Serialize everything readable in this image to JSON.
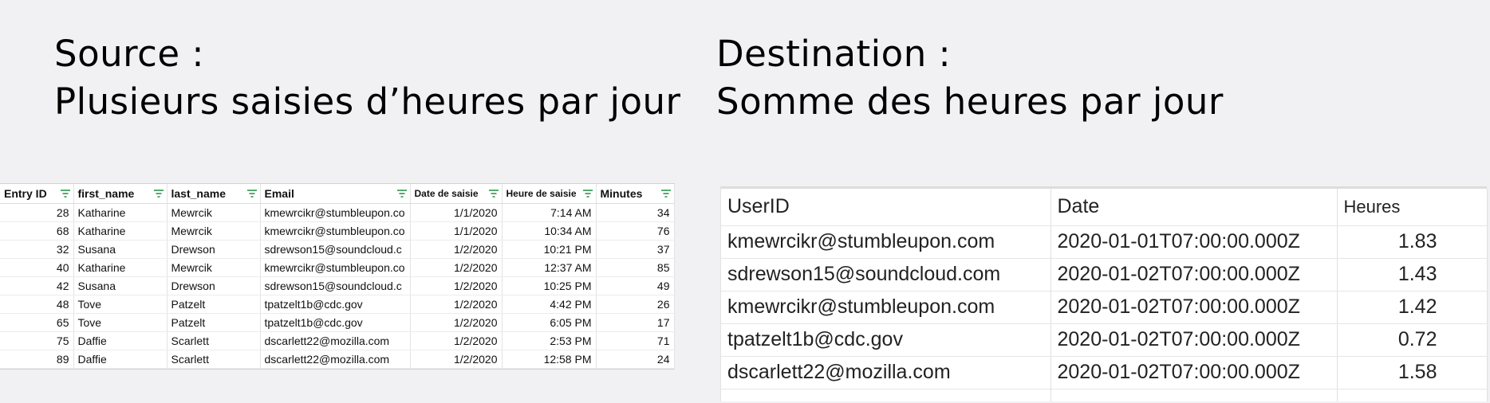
{
  "source": {
    "heading_line1": "Source :",
    "heading_line2": "Plusieurs saisies d’heures par jour",
    "columns": [
      "Entry ID",
      "first_name",
      "last_name",
      "Email",
      "Date de saisie",
      "Heure de saisie",
      "Minutes"
    ],
    "rows": [
      [
        "28",
        "Katharine",
        "Mewrcik",
        "kmewrcikr@stumbleupon.co",
        "1/1/2020",
        "7:14 AM",
        "34"
      ],
      [
        "68",
        "Katharine",
        "Mewrcik",
        "kmewrcikr@stumbleupon.co",
        "1/1/2020",
        "10:34 AM",
        "76"
      ],
      [
        "32",
        "Susana",
        "Drewson",
        "sdrewson15@soundcloud.c",
        "1/2/2020",
        "10:21 PM",
        "37"
      ],
      [
        "40",
        "Katharine",
        "Mewrcik",
        "kmewrcikr@stumbleupon.co",
        "1/2/2020",
        "12:37 AM",
        "85"
      ],
      [
        "42",
        "Susana",
        "Drewson",
        "sdrewson15@soundcloud.c",
        "1/2/2020",
        "10:25 PM",
        "49"
      ],
      [
        "48",
        "Tove",
        "Patzelt",
        "tpatzelt1b@cdc.gov",
        "1/2/2020",
        "4:42 PM",
        "26"
      ],
      [
        "65",
        "Tove",
        "Patzelt",
        "tpatzelt1b@cdc.gov",
        "1/2/2020",
        "6:05 PM",
        "17"
      ],
      [
        "75",
        "Daffie",
        "Scarlett",
        "dscarlett22@mozilla.com",
        "1/2/2020",
        "2:53 PM",
        "71"
      ],
      [
        "89",
        "Daffie",
        "Scarlett",
        "dscarlett22@mozilla.com",
        "1/2/2020",
        "12:58 PM",
        "24"
      ]
    ],
    "filter_color": "#1e8e3e"
  },
  "destination": {
    "heading_line1": "Destination :",
    "heading_line2": "Somme des heures par jour",
    "columns": [
      "UserID",
      "Date",
      "Heures"
    ],
    "rows": [
      [
        "kmewrcikr@stumbleupon.com",
        "2020-01-01T07:00:00.000Z",
        "1.83"
      ],
      [
        "sdrewson15@soundcloud.com",
        "2020-01-02T07:00:00.000Z",
        "1.43"
      ],
      [
        "kmewrcikr@stumbleupon.com",
        "2020-01-02T07:00:00.000Z",
        "1.42"
      ],
      [
        "tpatzelt1b@cdc.gov",
        "2020-01-02T07:00:00.000Z",
        "0.72"
      ],
      [
        "dscarlett22@mozilla.com",
        "2020-01-02T07:00:00.000Z",
        "1.58"
      ]
    ]
  }
}
